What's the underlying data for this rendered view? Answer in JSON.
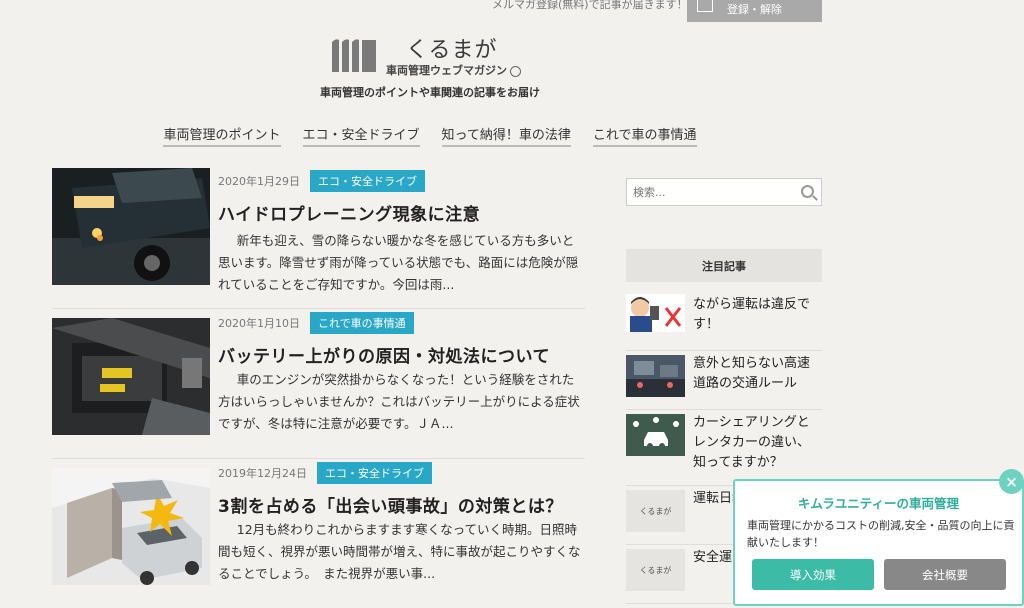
{
  "header": {
    "newsletter_text": "メルマガ登録(無料)で記事が届きます！",
    "newsletter_arrow": "→",
    "newsletter_button": "登録・解除",
    "logo_name": "くるまが",
    "logo_sub": "車両管理ウェブマガジン",
    "tagline": "車両管理のポイントや車関連の記事をお届け"
  },
  "nav": [
    {
      "label": "車両管理のポイント"
    },
    {
      "label": "エコ・安全ドライブ"
    },
    {
      "label": "知って納得！車の法律"
    },
    {
      "label": "これで車の事情通"
    }
  ],
  "articles": [
    {
      "date": "2020年1月29日",
      "category": "エコ・安全ドライブ",
      "title": "ハイドロプレーニング現象に注意",
      "excerpt": "新年も迎え、雪の降らない暖かな冬を感じている方も多いと思います。降雪せず雨が降っている状態でも、路面には危険が隠れていることをご存知ですか。今回は雨..."
    },
    {
      "date": "2020年1月10日",
      "category": "これで車の事情通",
      "title": "バッテリー上がりの原因・対処法について",
      "excerpt": "車のエンジンが突然掛からなくなった！という経験をされた方はいらっしゃいませんか？これはバッテリー上がりによる症状ですが、冬は特に注意が必要です。ＪＡ..."
    },
    {
      "date": "2019年12月24日",
      "category": "エコ・安全ドライブ",
      "title": "3割を占める「出会い頭事故」の対策とは？",
      "excerpt": "12月も終わりこれからますます寒くなっていく時期。日照時間も短く、視界が悪い時間帯が増え、特に事故が起こりやすくなることでしょう。　また視界が悪い事..."
    }
  ],
  "sidebar": {
    "search_placeholder": "検索...",
    "popular_heading": "注目記事",
    "popular": [
      {
        "title": "ながら運転は違反です！"
      },
      {
        "title": "意外と知らない高速道路の交通ルール"
      },
      {
        "title": "カーシェアリングとレンタカーの違い、知ってますか？"
      },
      {
        "title": "運転日報と活用"
      },
      {
        "title": "安全運出義務"
      }
    ],
    "thumb_logo": "くるまが"
  },
  "popup": {
    "title": "キムラユニティーの車両管理",
    "description": "車両管理にかかるコストの削減,安全・品質の向上に貢献いたします！",
    "button_primary": "導入効果",
    "button_secondary": "会社概要",
    "close": "×"
  },
  "colors": {
    "badge": "#29a7c7",
    "popup_accent": "#3cbca7",
    "background": "#f3f1ee"
  }
}
